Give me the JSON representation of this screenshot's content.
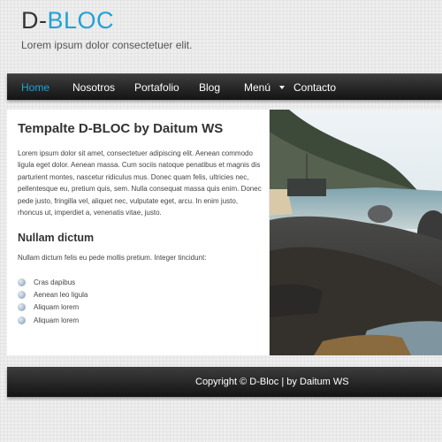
{
  "logo": {
    "part1": "D-",
    "part2": "BLOC"
  },
  "tagline": "Lorem ipsum dolor consectetuer elit.",
  "nav": {
    "items": [
      "Home",
      "Nosotros",
      "Portafolio",
      "Blog",
      "Menú",
      "Contacto"
    ],
    "active_index": 0
  },
  "main": {
    "title": "Tempalte D-BLOC by Daitum WS",
    "paragraph": "Lorem ipsum dolor sit amet, consectetuer adipiscing elit. Aenean commodo ligula eget dolor. Aenean massa. Cum sociis natoque penatibus et magnis dis parturient montes, nascetur ridiculus mus. Donec quam felis, ultricies nec, pellentesque eu, pretium quis, sem. Nulla consequat massa quis enim. Donec pede justo, fringilla vel, aliquet nec, vulputate eget, arcu. In enim justo, rhoncus ut, imperdiet a, venenatis vitae, justo.",
    "subtitle": "Nullam dictum",
    "subparagraph": "Nullam dictum felis eu pede mollis pretium. Integer tincidunt:",
    "list": [
      "Cras dapibus",
      "Aenean leo ligula",
      "Aliquam lorem",
      "Aliquam lorem"
    ]
  },
  "footer": {
    "text": "Copyright © D-Bloc | by Daitum WS"
  },
  "colors": {
    "accent": "#1fa3d6",
    "nav_bg": "#1f1f1f",
    "page_bg": "#eeeeee"
  }
}
